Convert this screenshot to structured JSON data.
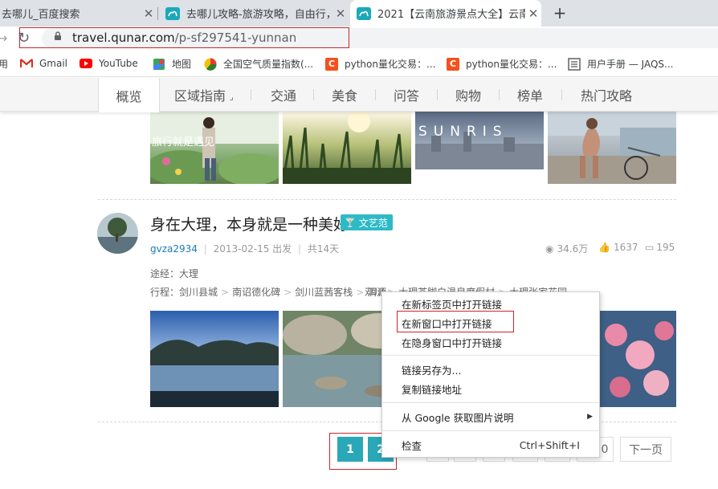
{
  "browser": {
    "tabs": [
      {
        "title": "去哪儿_百度搜索",
        "active": false
      },
      {
        "title": "去哪儿攻略-旅游攻略，自由行，",
        "active": false
      },
      {
        "title": "2021【云南旅游景点大全】云南",
        "active": true
      }
    ],
    "url_host": "travel.qunar.com",
    "url_path": "/p-sf297541-yunnan",
    "bookmarks": [
      {
        "label": "用",
        "icon": "apps-icon"
      },
      {
        "label": "Gmail",
        "icon": "gmail-icon"
      },
      {
        "label": "YouTube",
        "icon": "youtube-icon"
      },
      {
        "label": "地图",
        "icon": "maps-icon"
      },
      {
        "label": "全国空气质量指数(...",
        "icon": "aqi-icon"
      },
      {
        "label": "python量化交易：...",
        "icon": "c-icon"
      },
      {
        "label": "python量化交易：...",
        "icon": "c-icon"
      },
      {
        "label": "用户手册 — JAQS...",
        "icon": "doc-icon"
      }
    ]
  },
  "site_nav": {
    "items": [
      "概览",
      "区域指南",
      "交通",
      "美食",
      "问答",
      "购物",
      "榜单",
      "热门攻略"
    ],
    "active_index": 0
  },
  "post": {
    "title": "身在大理，本身就是一种美好",
    "tag": "文艺范",
    "author": "gvza2934",
    "date": "2013-02-15 出发",
    "duration": "共14天",
    "views": "34.6万",
    "likes": "1637",
    "comments": "195",
    "via_label": "途经：",
    "via_value": "大理",
    "route_label": "行程：",
    "route": [
      "剑川县城",
      "南诏德化碑",
      "剑川蓝茜客栈",
      "洱源",
      "邓川",
      "大理苍脚白温泉度假村",
      "大理张家花园"
    ]
  },
  "top_photo_text": {
    "sunrise": "SUNRIS",
    "overlay": "旅行就是遇见"
  },
  "pagination": {
    "pages": [
      "1",
      "2",
      "",
      "",
      "",
      "",
      "",
      "",
      "0"
    ],
    "active": "1",
    "next_label": "下一页"
  },
  "context_menu": {
    "items": [
      {
        "label": "在新标签页中打开链接"
      },
      {
        "label": "在新窗口中打开链接"
      },
      {
        "label": "在隐身窗口中打开链接"
      },
      {
        "label": "链接另存为..."
      },
      {
        "label": "复制链接地址"
      },
      {
        "label": "从 Google 获取图片说明"
      },
      {
        "label": "检查",
        "shortcut": "Ctrl+Shift+I"
      }
    ]
  },
  "colors": {
    "accent": "#2aa8b8",
    "tag_bg": "#2dbac7",
    "author": "#1a7bb9",
    "highlight": "#c9262a"
  }
}
